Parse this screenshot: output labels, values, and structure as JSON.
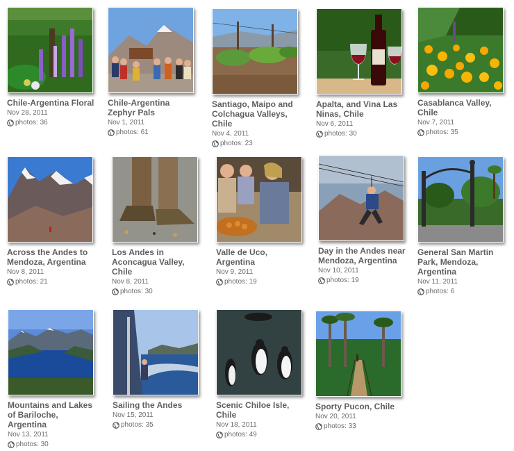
{
  "albums": [
    {
      "title": "Chile-Argentina Floral",
      "date": "Nov 28, 2011",
      "photos": "photos: 36",
      "scene": "flowers"
    },
    {
      "title": "Chile-Argentina Zephyr Pals",
      "date": "Nov 1, 2011",
      "photos": "photos: 61",
      "scene": "group"
    },
    {
      "title": "Santiago, Maipo and Colchagua Valleys, Chile",
      "date": "Nov 4, 2011",
      "photos": "photos: 23",
      "scene": "vineyard"
    },
    {
      "title": "Apalta, and Vina Las Ninas, Chile",
      "date": "Nov 6, 2011",
      "photos": "photos: 30",
      "scene": "wine"
    },
    {
      "title": "Casablanca Valley, Chile",
      "date": "Nov 7, 2011",
      "photos": "photos: 35",
      "scene": "poppies"
    },
    {
      "title": "Across the Andes to Mendoza, Argentina",
      "date": "Nov 8, 2011",
      "photos": "photos: 21",
      "scene": "mountains"
    },
    {
      "title": "Los Andes in Aconcagua Valley, Chile",
      "date": "Nov 8, 2011",
      "photos": "photos: 30",
      "scene": "boots"
    },
    {
      "title": "Valle de Uco, Argentina",
      "date": "Nov 9, 2011",
      "photos": "photos: 19",
      "scene": "people"
    },
    {
      "title": "Day in the Andes near Mendoza, Argentina",
      "date": "Nov 10, 2011",
      "photos": "photos: 19",
      "scene": "zipline"
    },
    {
      "title": "General San Martin Park, Mendoza, Argentina",
      "date": "Nov 11, 2011",
      "photos": "photos: 6",
      "scene": "park"
    },
    {
      "title": "Mountains and Lakes of Bariloche, Argentina",
      "date": "Nov 13, 2011",
      "photos": "photos: 30",
      "scene": "lake"
    },
    {
      "title": "Sailing the Andes",
      "date": "Nov 15, 2011",
      "photos": "photos: 35",
      "scene": "boat"
    },
    {
      "title": "Scenic Chiloe Isle, Chile",
      "date": "Nov 18, 2011",
      "photos": "photos: 49",
      "scene": "penguins"
    },
    {
      "title": "Sporty Pucon, Chile",
      "date": "Nov 20, 2011",
      "photos": "photos: 33",
      "scene": "bridge"
    }
  ]
}
